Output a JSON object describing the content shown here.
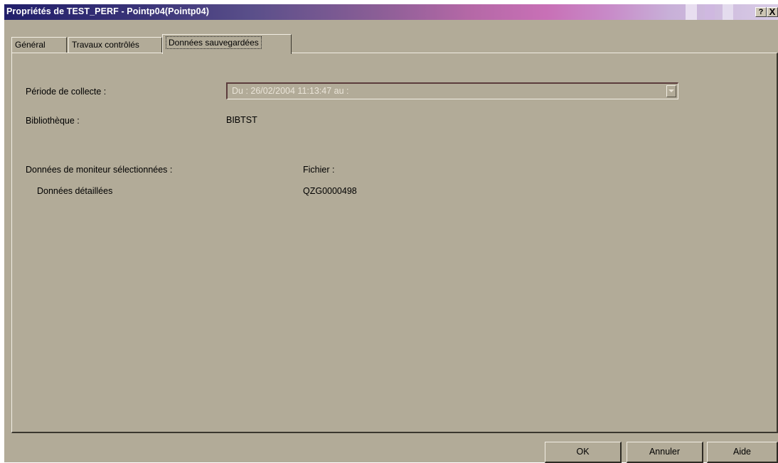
{
  "window": {
    "title": "Propriétés de TEST_PERF - Pointp04(Pointp04)",
    "help_glyph": "?",
    "close_glyph": "X"
  },
  "tabs": [
    {
      "label": "Général"
    },
    {
      "label": "Travaux contrôlés"
    },
    {
      "label": "Données sauvegardées",
      "active": true
    }
  ],
  "form": {
    "period_label": "Période de collecte :",
    "period_value": "Du :   26/02/2004  11:13:47  au :",
    "library_label": "Bibliothèque :",
    "library_value": "BIBTST",
    "monitor_label": "Données de moniteur sélectionnées :",
    "file_label": "Fichier :",
    "detail_label": "Données détaillées",
    "detail_file": "QZG0000498"
  },
  "buttons": {
    "ok": "OK",
    "cancel": "Annuler",
    "help": "Aide"
  },
  "colors": {
    "face": "#b2ab98",
    "title_start": "#211f6a",
    "title_end": "#d8cce6"
  }
}
